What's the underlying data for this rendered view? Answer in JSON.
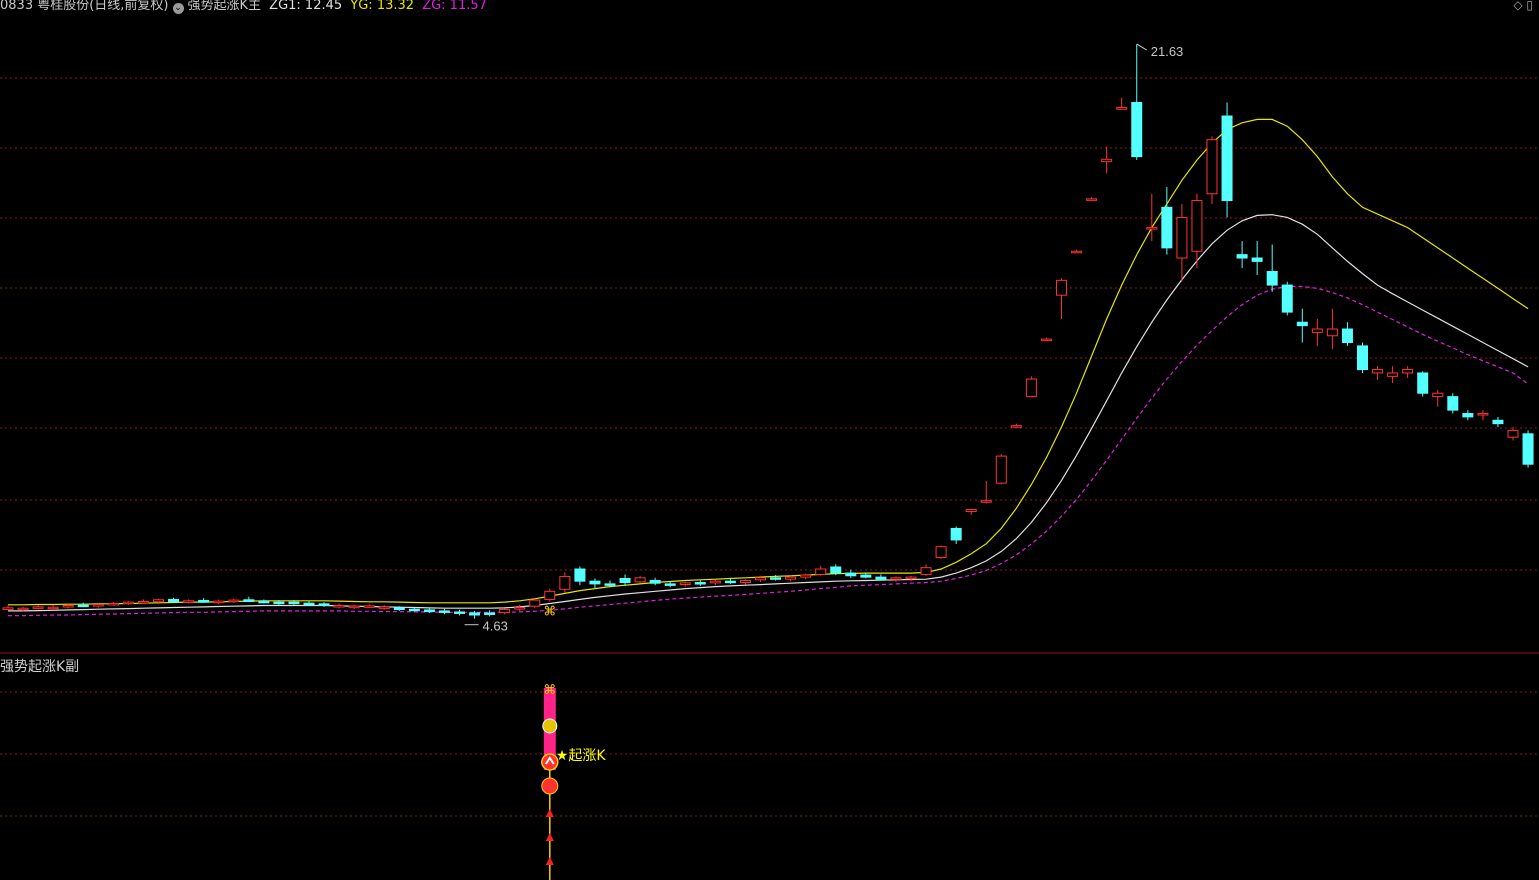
{
  "header": {
    "stock": "0833 粤桂股份(日线,前复权)",
    "indicator": "强势起涨K主",
    "zg1": "ZG1: 12.45",
    "yg": "YG: 13.32",
    "zg": "ZG: 11.57",
    "icon": "diamond-icon"
  },
  "colors": {
    "background": "#000000",
    "up": "#ff3232",
    "down": "#54ffff",
    "yg_line": "#e6e600",
    "zg1_line": "#e0e0e0",
    "zg_line": "#e020e0",
    "grid": "#8b1a1a",
    "label": "#c8c8c8",
    "yellow_label": "#ffff00"
  },
  "sub_panel": {
    "title": "强势起涨K副",
    "signal_label": "★起涨K"
  },
  "chart_data": {
    "type": "candlestick",
    "price_range": [
      4.0,
      22.4
    ],
    "high_label": "21.63",
    "low_label": "4.63",
    "candles": [
      {
        "o": 4.95,
        "h": 5.02,
        "l": 4.88,
        "c": 4.9,
        "d": "up"
      },
      {
        "o": 4.9,
        "h": 4.98,
        "l": 4.85,
        "c": 4.94,
        "d": "up"
      },
      {
        "o": 4.96,
        "h": 5.04,
        "l": 4.9,
        "c": 4.98,
        "d": "up"
      },
      {
        "o": 4.97,
        "h": 5.03,
        "l": 4.92,
        "c": 4.96,
        "d": "up"
      },
      {
        "o": 4.98,
        "h": 5.06,
        "l": 4.94,
        "c": 5.02,
        "d": "up"
      },
      {
        "o": 5.03,
        "h": 5.1,
        "l": 4.98,
        "c": 5.01,
        "d": "down"
      },
      {
        "o": 5.02,
        "h": 5.08,
        "l": 4.96,
        "c": 5.05,
        "d": "up"
      },
      {
        "o": 5.06,
        "h": 5.12,
        "l": 5.01,
        "c": 5.08,
        "d": "up"
      },
      {
        "o": 5.09,
        "h": 5.15,
        "l": 5.04,
        "c": 5.12,
        "d": "up"
      },
      {
        "o": 5.14,
        "h": 5.2,
        "l": 5.08,
        "c": 5.1,
        "d": "up"
      },
      {
        "o": 5.13,
        "h": 5.22,
        "l": 5.06,
        "c": 5.19,
        "d": "up"
      },
      {
        "o": 5.2,
        "h": 5.25,
        "l": 5.1,
        "c": 5.13,
        "d": "down"
      },
      {
        "o": 5.14,
        "h": 5.2,
        "l": 5.08,
        "c": 5.16,
        "d": "up"
      },
      {
        "o": 5.17,
        "h": 5.24,
        "l": 5.1,
        "c": 5.12,
        "d": "down"
      },
      {
        "o": 5.13,
        "h": 5.2,
        "l": 5.06,
        "c": 5.15,
        "d": "up"
      },
      {
        "o": 5.16,
        "h": 5.22,
        "l": 5.1,
        "c": 5.18,
        "d": "up"
      },
      {
        "o": 5.19,
        "h": 5.28,
        "l": 5.12,
        "c": 5.14,
        "d": "down"
      },
      {
        "o": 5.15,
        "h": 5.2,
        "l": 5.08,
        "c": 5.1,
        "d": "down"
      },
      {
        "o": 5.1,
        "h": 5.18,
        "l": 5.04,
        "c": 5.12,
        "d": "down"
      },
      {
        "o": 5.12,
        "h": 5.18,
        "l": 5.04,
        "c": 5.08,
        "d": "down"
      },
      {
        "o": 5.09,
        "h": 5.14,
        "l": 5.02,
        "c": 5.06,
        "d": "down"
      },
      {
        "o": 5.07,
        "h": 5.12,
        "l": 4.98,
        "c": 5.02,
        "d": "down"
      },
      {
        "o": 5.02,
        "h": 5.08,
        "l": 4.95,
        "c": 4.98,
        "d": "up"
      },
      {
        "o": 4.97,
        "h": 5.04,
        "l": 4.92,
        "c": 5.0,
        "d": "up"
      },
      {
        "o": 5.01,
        "h": 5.06,
        "l": 4.94,
        "c": 4.97,
        "d": "up"
      },
      {
        "o": 4.98,
        "h": 5.03,
        "l": 4.9,
        "c": 4.94,
        "d": "up"
      },
      {
        "o": 4.95,
        "h": 5.0,
        "l": 4.86,
        "c": 4.9,
        "d": "down"
      },
      {
        "o": 4.91,
        "h": 4.97,
        "l": 4.84,
        "c": 4.88,
        "d": "down"
      },
      {
        "o": 4.89,
        "h": 4.95,
        "l": 4.8,
        "c": 4.84,
        "d": "down"
      },
      {
        "o": 4.86,
        "h": 4.92,
        "l": 4.76,
        "c": 4.82,
        "d": "down"
      },
      {
        "o": 4.83,
        "h": 4.9,
        "l": 4.73,
        "c": 4.8,
        "d": "down"
      },
      {
        "o": 4.8,
        "h": 4.86,
        "l": 4.63,
        "c": 4.74,
        "d": "down"
      },
      {
        "o": 4.76,
        "h": 4.88,
        "l": 4.7,
        "c": 4.8,
        "d": "down"
      },
      {
        "o": 4.81,
        "h": 4.94,
        "l": 4.76,
        "c": 4.9,
        "d": "up"
      },
      {
        "o": 4.92,
        "h": 5.04,
        "l": 4.86,
        "c": 4.96,
        "d": "up"
      },
      {
        "o": 5.0,
        "h": 5.22,
        "l": 4.94,
        "c": 5.18,
        "d": "up"
      },
      {
        "o": 5.2,
        "h": 5.52,
        "l": 5.14,
        "c": 5.44,
        "d": "up"
      },
      {
        "o": 5.5,
        "h": 6.0,
        "l": 5.4,
        "c": 5.88,
        "d": "up"
      },
      {
        "o": 6.1,
        "h": 6.18,
        "l": 5.62,
        "c": 5.74,
        "d": "down"
      },
      {
        "o": 5.74,
        "h": 5.82,
        "l": 5.52,
        "c": 5.66,
        "d": "down"
      },
      {
        "o": 5.66,
        "h": 5.76,
        "l": 5.58,
        "c": 5.62,
        "d": "down"
      },
      {
        "o": 5.7,
        "h": 5.94,
        "l": 5.6,
        "c": 5.82,
        "d": "down"
      },
      {
        "o": 5.84,
        "h": 5.9,
        "l": 5.68,
        "c": 5.72,
        "d": "up"
      },
      {
        "o": 5.76,
        "h": 5.84,
        "l": 5.62,
        "c": 5.68,
        "d": "down"
      },
      {
        "o": 5.66,
        "h": 5.74,
        "l": 5.56,
        "c": 5.64,
        "d": "down"
      },
      {
        "o": 5.64,
        "h": 5.72,
        "l": 5.58,
        "c": 5.69,
        "d": "up"
      },
      {
        "o": 5.68,
        "h": 5.76,
        "l": 5.6,
        "c": 5.7,
        "d": "down"
      },
      {
        "o": 5.69,
        "h": 5.78,
        "l": 5.62,
        "c": 5.74,
        "d": "up"
      },
      {
        "o": 5.74,
        "h": 5.84,
        "l": 5.66,
        "c": 5.7,
        "d": "down"
      },
      {
        "o": 5.7,
        "h": 5.8,
        "l": 5.64,
        "c": 5.76,
        "d": "up"
      },
      {
        "o": 5.78,
        "h": 5.9,
        "l": 5.72,
        "c": 5.84,
        "d": "up"
      },
      {
        "o": 5.84,
        "h": 5.92,
        "l": 5.76,
        "c": 5.8,
        "d": "down"
      },
      {
        "o": 5.8,
        "h": 5.9,
        "l": 5.74,
        "c": 5.86,
        "d": "up"
      },
      {
        "o": 5.86,
        "h": 5.96,
        "l": 5.8,
        "c": 5.92,
        "d": "up"
      },
      {
        "o": 5.94,
        "h": 6.2,
        "l": 5.9,
        "c": 6.1,
        "d": "up"
      },
      {
        "o": 6.16,
        "h": 6.24,
        "l": 5.92,
        "c": 5.98,
        "d": "down"
      },
      {
        "o": 5.98,
        "h": 6.08,
        "l": 5.84,
        "c": 5.9,
        "d": "down"
      },
      {
        "o": 5.92,
        "h": 6.0,
        "l": 5.82,
        "c": 5.86,
        "d": "down"
      },
      {
        "o": 5.86,
        "h": 5.94,
        "l": 5.76,
        "c": 5.8,
        "d": "down"
      },
      {
        "o": 5.8,
        "h": 5.88,
        "l": 5.72,
        "c": 5.84,
        "d": "up"
      },
      {
        "o": 5.82,
        "h": 5.9,
        "l": 5.74,
        "c": 5.86,
        "d": "up"
      },
      {
        "o": 5.94,
        "h": 6.24,
        "l": 5.9,
        "c": 6.14,
        "d": "up"
      },
      {
        "o": 6.44,
        "h": 6.8,
        "l": 6.4,
        "c": 6.76,
        "d": "up"
      },
      {
        "o": 7.3,
        "h": 7.36,
        "l": 6.84,
        "c": 6.96,
        "d": "down"
      },
      {
        "o": 7.8,
        "h": 7.88,
        "l": 7.7,
        "c": 7.86,
        "d": "up"
      },
      {
        "o": 8.1,
        "h": 8.7,
        "l": 8.04,
        "c": 8.12,
        "d": "up"
      },
      {
        "o": 8.64,
        "h": 9.5,
        "l": 8.6,
        "c": 9.44,
        "d": "up"
      },
      {
        "o": 10.34,
        "h": 10.4,
        "l": 10.32,
        "c": 10.34,
        "d": "up"
      },
      {
        "o": 11.2,
        "h": 11.8,
        "l": 11.18,
        "c": 11.72,
        "d": "up"
      },
      {
        "o": 12.9,
        "h": 12.94,
        "l": 12.88,
        "c": 12.9,
        "d": "up"
      },
      {
        "o": 14.2,
        "h": 14.7,
        "l": 13.5,
        "c": 14.64,
        "d": "up"
      },
      {
        "o": 15.5,
        "h": 15.54,
        "l": 15.48,
        "c": 15.5,
        "d": "up"
      },
      {
        "o": 17.05,
        "h": 17.1,
        "l": 17.03,
        "c": 17.05,
        "d": "up"
      },
      {
        "o": 18.15,
        "h": 18.6,
        "l": 17.8,
        "c": 18.22,
        "d": "up"
      },
      {
        "o": 19.7,
        "h": 20.04,
        "l": 19.68,
        "c": 19.75,
        "d": "up"
      },
      {
        "o": 19.9,
        "h": 21.63,
        "l": 18.2,
        "c": 18.3,
        "d": "down"
      },
      {
        "o": 16.2,
        "h": 17.2,
        "l": 15.8,
        "c": 16.2,
        "d": "up"
      },
      {
        "o": 16.8,
        "h": 17.4,
        "l": 15.4,
        "c": 15.6,
        "d": "down"
      },
      {
        "o": 15.3,
        "h": 16.9,
        "l": 14.6,
        "c": 16.5,
        "d": "up"
      },
      {
        "o": 15.5,
        "h": 17.2,
        "l": 15.0,
        "c": 17.0,
        "d": "up"
      },
      {
        "o": 17.2,
        "h": 18.9,
        "l": 16.9,
        "c": 18.8,
        "d": "up"
      },
      {
        "o": 19.5,
        "h": 19.9,
        "l": 16.5,
        "c": 17.0,
        "d": "down"
      },
      {
        "o": 15.4,
        "h": 15.8,
        "l": 15.0,
        "c": 15.3,
        "d": "down"
      },
      {
        "o": 15.3,
        "h": 15.8,
        "l": 14.8,
        "c": 15.2,
        "d": "down"
      },
      {
        "o": 14.9,
        "h": 15.7,
        "l": 14.3,
        "c": 14.5,
        "d": "down"
      },
      {
        "o": 14.5,
        "h": 14.6,
        "l": 13.6,
        "c": 13.7,
        "d": "down"
      },
      {
        "o": 13.4,
        "h": 13.8,
        "l": 12.8,
        "c": 13.3,
        "d": "down"
      },
      {
        "o": 13.1,
        "h": 13.5,
        "l": 12.7,
        "c": 13.2,
        "d": "up"
      },
      {
        "o": 13.0,
        "h": 13.8,
        "l": 12.6,
        "c": 13.2,
        "d": "up"
      },
      {
        "o": 13.2,
        "h": 13.4,
        "l": 12.7,
        "c": 12.8,
        "d": "down"
      },
      {
        "o": 12.7,
        "h": 12.8,
        "l": 11.9,
        "c": 12.0,
        "d": "down"
      },
      {
        "o": 11.9,
        "h": 12.1,
        "l": 11.7,
        "c": 12.0,
        "d": "up"
      },
      {
        "o": 11.8,
        "h": 12.1,
        "l": 11.6,
        "c": 11.9,
        "d": "up"
      },
      {
        "o": 11.9,
        "h": 12.1,
        "l": 11.75,
        "c": 12.0,
        "d": "up"
      },
      {
        "o": 11.9,
        "h": 11.95,
        "l": 11.2,
        "c": 11.3,
        "d": "down"
      },
      {
        "o": 11.2,
        "h": 11.4,
        "l": 10.9,
        "c": 11.3,
        "d": "up"
      },
      {
        "o": 11.2,
        "h": 11.3,
        "l": 10.7,
        "c": 10.8,
        "d": "down"
      },
      {
        "o": 10.7,
        "h": 10.8,
        "l": 10.5,
        "c": 10.6,
        "d": "down"
      },
      {
        "o": 10.7,
        "h": 10.8,
        "l": 10.5,
        "c": 10.7,
        "d": "up"
      },
      {
        "o": 10.5,
        "h": 10.6,
        "l": 10.3,
        "c": 10.4,
        "d": "down"
      },
      {
        "o": 10.0,
        "h": 10.3,
        "l": 9.9,
        "c": 10.2,
        "d": "up"
      },
      {
        "o": 10.1,
        "h": 10.2,
        "l": 9.1,
        "c": 9.2,
        "d": "down"
      }
    ],
    "series": [
      {
        "name": "YG",
        "values": [
          5.04,
          5.04,
          5.05,
          5.05,
          5.06,
          5.06,
          5.07,
          5.07,
          5.08,
          5.09,
          5.1,
          5.11,
          5.12,
          5.12,
          5.13,
          5.14,
          5.15,
          5.16,
          5.16,
          5.16,
          5.16,
          5.16,
          5.15,
          5.14,
          5.13,
          5.13,
          5.12,
          5.11,
          5.1,
          5.1,
          5.1,
          5.1,
          5.1,
          5.12,
          5.16,
          5.22,
          5.3,
          5.38,
          5.46,
          5.52,
          5.58,
          5.62,
          5.66,
          5.7,
          5.73,
          5.76,
          5.78,
          5.8,
          5.82,
          5.84,
          5.86,
          5.88,
          5.9,
          5.92,
          5.94,
          5.96,
          5.97,
          5.98,
          5.98,
          5.98,
          5.98,
          6.0,
          6.1,
          6.3,
          6.55,
          6.85,
          7.3,
          7.9,
          8.6,
          9.4,
          10.3,
          11.3,
          12.4,
          13.5,
          14.5,
          15.4,
          16.2,
          16.9,
          17.6,
          18.2,
          18.7,
          19.1,
          19.3,
          19.4,
          19.4,
          19.2,
          18.8,
          18.3,
          17.7,
          17.2,
          16.8,
          16.6,
          16.4,
          16.2,
          15.9,
          15.6,
          15.3,
          15.0,
          14.7,
          14.4,
          14.1,
          13.8
        ]
      },
      {
        "name": "ZG1",
        "values": [
          4.86,
          4.86,
          4.87,
          4.88,
          4.89,
          4.9,
          4.91,
          4.92,
          4.93,
          4.94,
          4.95,
          4.96,
          4.97,
          4.98,
          4.99,
          5.0,
          5.01,
          5.02,
          5.02,
          5.02,
          5.02,
          5.02,
          5.01,
          5.0,
          4.99,
          4.98,
          4.97,
          4.96,
          4.95,
          4.94,
          4.94,
          4.94,
          4.94,
          4.95,
          4.98,
          5.02,
          5.08,
          5.14,
          5.2,
          5.26,
          5.31,
          5.36,
          5.4,
          5.44,
          5.48,
          5.52,
          5.55,
          5.58,
          5.6,
          5.62,
          5.64,
          5.66,
          5.68,
          5.7,
          5.72,
          5.74,
          5.75,
          5.76,
          5.77,
          5.78,
          5.79,
          5.8,
          5.86,
          5.98,
          6.14,
          6.34,
          6.62,
          7.0,
          7.48,
          8.06,
          8.72,
          9.46,
          10.26,
          11.08,
          11.9,
          12.68,
          13.4,
          14.06,
          14.66,
          15.22,
          15.72,
          16.12,
          16.4,
          16.56,
          16.58,
          16.5,
          16.3,
          16.0,
          15.6,
          15.2,
          14.84,
          14.5,
          14.24,
          14.0,
          13.76,
          13.52,
          13.28,
          13.04,
          12.8,
          12.56,
          12.32,
          12.08
        ]
      },
      {
        "name": "ZG",
        "values": [
          4.72,
          4.72,
          4.73,
          4.74,
          4.74,
          4.75,
          4.76,
          4.77,
          4.78,
          4.79,
          4.8,
          4.81,
          4.82,
          4.82,
          4.83,
          4.84,
          4.85,
          4.86,
          4.86,
          4.86,
          4.86,
          4.86,
          4.86,
          4.85,
          4.85,
          4.84,
          4.84,
          4.83,
          4.83,
          4.82,
          4.82,
          4.82,
          4.82,
          4.82,
          4.83,
          4.85,
          4.88,
          4.92,
          4.97,
          5.01,
          5.05,
          5.09,
          5.13,
          5.17,
          5.21,
          5.24,
          5.27,
          5.3,
          5.32,
          5.35,
          5.38,
          5.41,
          5.44,
          5.48,
          5.52,
          5.56,
          5.6,
          5.62,
          5.64,
          5.66,
          5.68,
          5.7,
          5.74,
          5.82,
          5.92,
          6.06,
          6.26,
          6.52,
          6.84,
          7.22,
          7.66,
          8.16,
          8.72,
          9.32,
          9.94,
          10.56,
          11.16,
          11.72,
          12.24,
          12.72,
          13.16,
          13.56,
          13.92,
          14.2,
          14.38,
          14.46,
          14.46,
          14.4,
          14.28,
          14.12,
          13.92,
          13.7,
          13.48,
          13.26,
          13.04,
          12.84,
          12.64,
          12.44,
          12.26,
          12.08,
          11.9,
          11.57
        ]
      }
    ],
    "signal_index": 36
  }
}
